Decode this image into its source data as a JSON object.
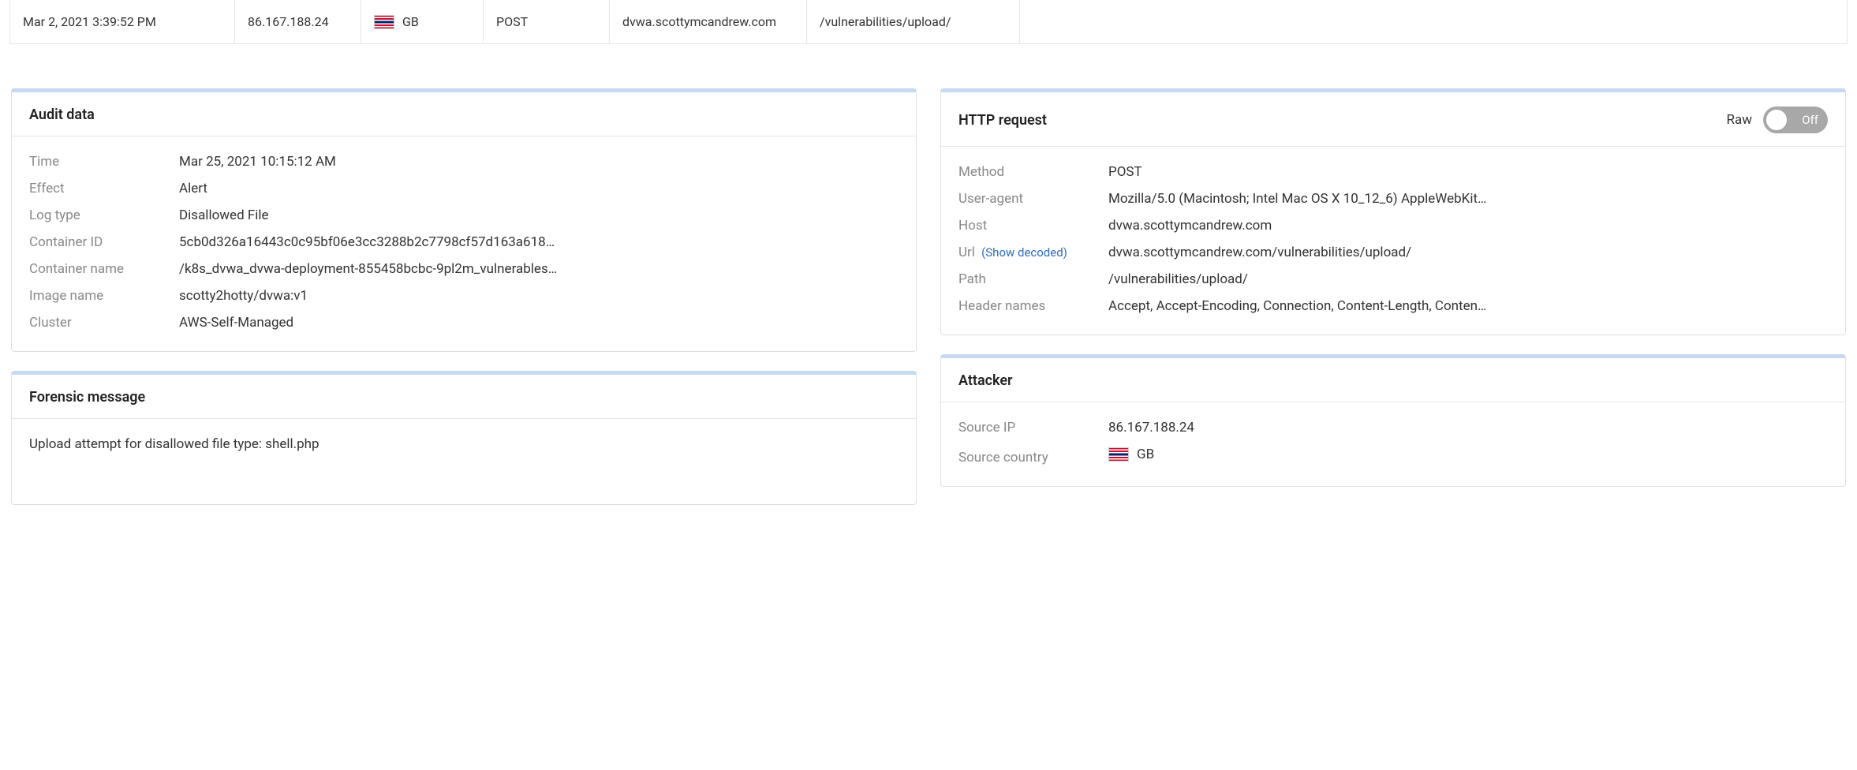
{
  "top_row": {
    "date": "Mar 2, 2021 3:39:52 PM",
    "ip": "86.167.188.24",
    "country": "GB",
    "method": "POST",
    "host": "dvwa.scottymcandrew.com",
    "url": "/vulnerabilities/upload/"
  },
  "audit_data": {
    "title": "Audit data",
    "rows": {
      "time": {
        "label": "Time",
        "value": "Mar 25, 2021 10:15:12 AM"
      },
      "effect": {
        "label": "Effect",
        "value": "Alert"
      },
      "log_type": {
        "label": "Log type",
        "value": "Disallowed File"
      },
      "container_id": {
        "label": "Container ID",
        "value": "5cb0d326a16443c0c95bf06e3cc3288b2c7798cf57d163a618…"
      },
      "container_name": {
        "label": "Container name",
        "value": "/k8s_dvwa_dvwa-deployment-855458bcbc-9pl2m_vulnerables…"
      },
      "image_name": {
        "label": "Image name",
        "value": "scotty2hotty/dvwa:v1"
      },
      "cluster": {
        "label": "Cluster",
        "value": "AWS-Self-Managed"
      }
    }
  },
  "http_request": {
    "title": "HTTP request",
    "raw_label": "Raw",
    "toggle_text": "Off",
    "rows": {
      "method": {
        "label": "Method",
        "value": "POST"
      },
      "user_agent": {
        "label": "User-agent",
        "value": "Mozilla/5.0 (Macintosh; Intel Mac OS X 10_12_6) AppleWebKit…"
      },
      "host": {
        "label": "Host",
        "value": "dvwa.scottymcandrew.com"
      },
      "url": {
        "label": "Url",
        "show_decoded": "(Show decoded)",
        "value": "dvwa.scottymcandrew.com/vulnerabilities/upload/"
      },
      "path": {
        "label": "Path",
        "value": "/vulnerabilities/upload/"
      },
      "header_names": {
        "label": "Header names",
        "value": "Accept, Accept-Encoding, Connection, Content-Length, Conten…"
      }
    }
  },
  "forensic_message": {
    "title": "Forensic message",
    "message": "Upload attempt for disallowed file type: shell.php"
  },
  "attacker": {
    "title": "Attacker",
    "rows": {
      "source_ip": {
        "label": "Source IP",
        "value": "86.167.188.24"
      },
      "source_country": {
        "label": "Source country",
        "value": "GB"
      }
    }
  }
}
